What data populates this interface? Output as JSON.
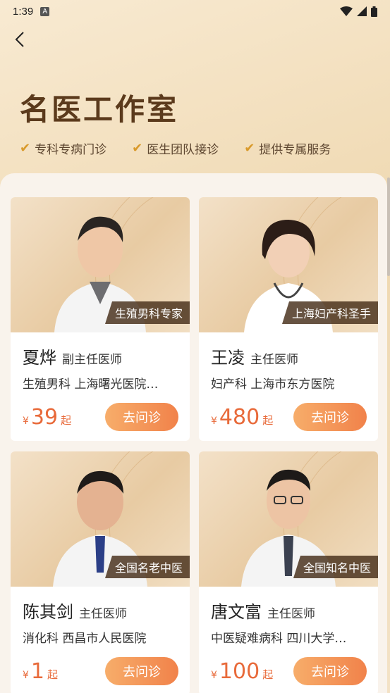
{
  "status_bar": {
    "time": "1:39",
    "badge": "A"
  },
  "header": {
    "title": "名医工作室",
    "features": [
      "专科专病门诊",
      "医生团队接诊",
      "提供专属服务"
    ]
  },
  "doctors": [
    {
      "name": "夏烨",
      "title": "副主任医师",
      "department": "生殖男科 上海曙光医院…",
      "tag": "生殖男科专家",
      "currency": "¥",
      "price": "39",
      "suffix": "起",
      "button": "去问诊"
    },
    {
      "name": "王凌",
      "title": "主任医师",
      "department": "妇产科 上海市东方医院",
      "tag": "上海妇产科圣手",
      "currency": "¥",
      "price": "480",
      "suffix": "起",
      "button": "去问诊"
    },
    {
      "name": "陈其剑",
      "title": "主任医师",
      "department": "消化科 西昌市人民医院",
      "tag": "全国名老中医",
      "currency": "¥",
      "price": "1",
      "suffix": "起",
      "button": "去问诊"
    },
    {
      "name": "唐文富",
      "title": "主任医师",
      "department": "中医疑难病科 四川大学…",
      "tag": "全国知名中医",
      "currency": "¥",
      "price": "100",
      "suffix": "起",
      "button": "去问诊"
    }
  ],
  "colors": {
    "accent": "#f1824a",
    "price": "#e86a3a",
    "title": "#5b3a1c",
    "check": "#d99a2b"
  }
}
